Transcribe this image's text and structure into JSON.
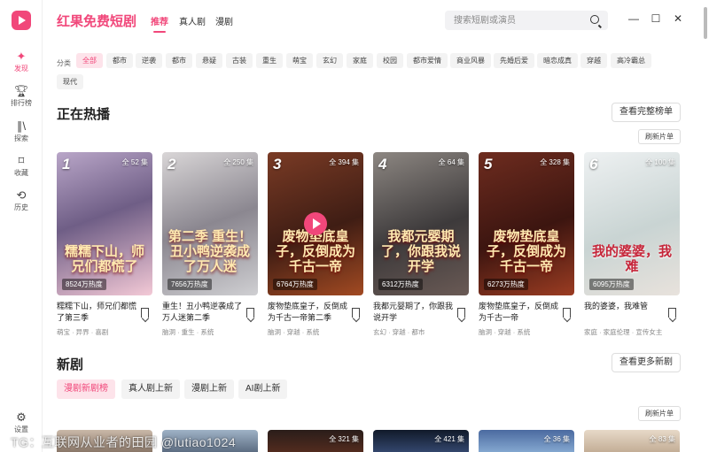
{
  "app": {
    "brand": "红果免费短剧"
  },
  "top_tabs": [
    {
      "label": "推荐",
      "active": true
    },
    {
      "label": "真人剧",
      "active": false
    },
    {
      "label": "漫剧",
      "active": false
    }
  ],
  "search": {
    "placeholder": "搜索短剧或演员"
  },
  "sidebar": {
    "items": [
      {
        "label": "发现",
        "icon": "sparkle-icon",
        "active": true
      },
      {
        "label": "排行榜",
        "icon": "trophy-icon",
        "active": false
      },
      {
        "label": "探索",
        "icon": "library-icon",
        "active": false
      },
      {
        "label": "收藏",
        "icon": "bookmark-icon",
        "active": false
      },
      {
        "label": "历史",
        "icon": "history-icon",
        "active": false
      },
      {
        "label": "设置",
        "icon": "gear-icon",
        "active": false
      }
    ]
  },
  "filters": {
    "label": "分类",
    "chips": [
      "全部",
      "都市",
      "逆袭",
      "都市",
      "悬疑",
      "古装",
      "重生",
      "萌宝",
      "玄幻",
      "家庭",
      "校园",
      "都市爱情",
      "商业风暴",
      "先婚后爱",
      "暗恋成真",
      "穿越",
      "高冷霸总",
      "现代"
    ]
  },
  "hot": {
    "title": "正在热播",
    "view_all": "查看完整榜单",
    "refresh": "刷新片单",
    "cards": [
      {
        "rank": "1",
        "episodes": "全 52 集",
        "heat": "8524万热度",
        "poster_text": "糯糯下山，师兄们都慌了",
        "title": "糯糯下山，师兄们都慌了第三季",
        "tags": "萌宝 · 异界 · 喜剧",
        "bg": "linear-gradient(160deg,#b9a6c8 0%,#6f5e86 45%,#f3c9d6 100%)"
      },
      {
        "rank": "2",
        "episodes": "全 250 集",
        "heat": "7656万热度",
        "poster_text": "第二季 重生！丑小鸭逆袭成了万人迷",
        "title": "重生！丑小鸭逆袭成了万人迷第二季",
        "tags": "脑洞 · 重生 · 系统",
        "bg": "linear-gradient(160deg,#d9d6d7 0%,#8b8790 50%,#cfcfd2 100%)"
      },
      {
        "rank": "3",
        "episodes": "全 394 集",
        "heat": "6764万热度",
        "poster_text": "废物垫底皇子，反倒成为千古一帝",
        "title": "废物垫底皇子，反倒成为千古一帝第二季",
        "tags": "脑洞 · 穿越 · 系统",
        "bg": "linear-gradient(160deg,#7a3b25 0%,#3f1d14 55%,#a24a22 100%)"
      },
      {
        "rank": "4",
        "episodes": "全 64 集",
        "heat": "6312万热度",
        "poster_text": "我都元婴期了，你跟我说开学",
        "title": "我都元婴期了，你跟我说开学",
        "tags": "玄幻 · 穿越 · 都市",
        "bg": "linear-gradient(160deg,#8d8782 0%,#3d3a3b 55%,#6a5a55 100%)"
      },
      {
        "rank": "5",
        "episodes": "全 328 集",
        "heat": "6273万热度",
        "poster_text": "废物垫底皇子，反倒成为千古一帝",
        "title": "废物垫底皇子，反倒成为千古一帝",
        "tags": "脑洞 · 穿越 · 系统",
        "bg": "linear-gradient(160deg,#6e2c1f 0%,#3c1510 55%,#9b3c22 100%)"
      },
      {
        "rank": "6",
        "episodes": "全 100 集",
        "heat": "6095万热度",
        "poster_text": "我的婆婆，我难",
        "title": "我的婆婆，我难管",
        "tags": "家庭 · 家庭伦理 · 宣传女主",
        "bg": "linear-gradient(160deg,#eef1f2 0%,#c9d4d3 55%,#e8e2dc 100%)"
      }
    ]
  },
  "new": {
    "title": "新剧",
    "view_all": "查看更多新剧",
    "refresh": "刷新片单",
    "tabs": [
      {
        "label": "漫剧新剧榜",
        "active": true
      },
      {
        "label": "真人剧上新",
        "active": false
      },
      {
        "label": "漫剧上新",
        "active": false
      },
      {
        "label": "AI剧上新",
        "active": false
      }
    ],
    "thumbs": [
      {
        "episodes": "",
        "bg": "linear-gradient(180deg,#c9b8a8,#7d6a5c)"
      },
      {
        "episodes": "",
        "bg": "linear-gradient(180deg,#9fb2c6,#4f5f74)"
      },
      {
        "episodes": "全 321 集",
        "bg": "linear-gradient(180deg,#2a1d1a,#5a2e1f)"
      },
      {
        "episodes": "全 421 集",
        "bg": "linear-gradient(180deg,#111a2a,#3a4f7a)"
      },
      {
        "episodes": "全 36 集",
        "bg": "linear-gradient(180deg,#4b6aa0,#8fb3d9)"
      },
      {
        "episodes": "全 83 集",
        "bg": "linear-gradient(180deg,#e7d9c8,#bca58c)"
      }
    ]
  },
  "watermark": "TG：互联网从业者的田园 @lutiao1024"
}
